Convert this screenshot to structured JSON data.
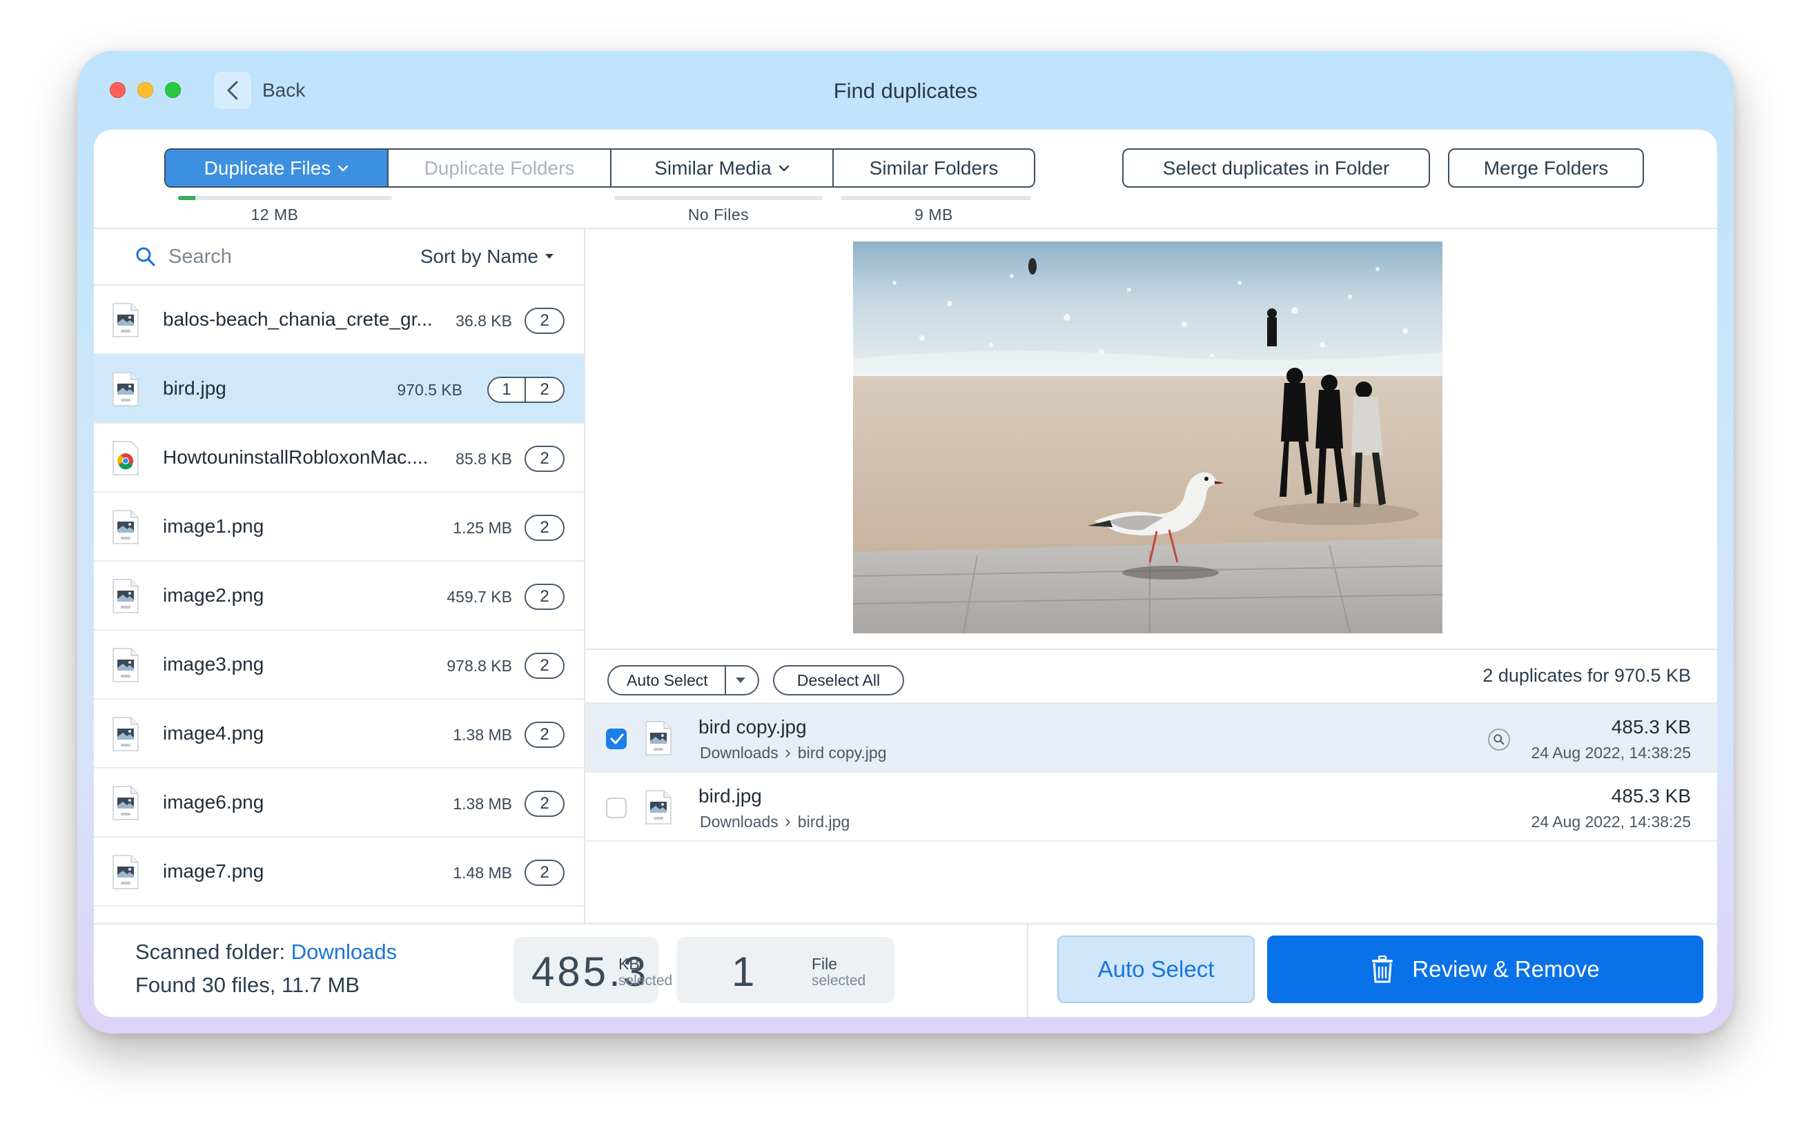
{
  "window": {
    "back_label": "Back",
    "title": "Find duplicates"
  },
  "tabs": [
    {
      "label": "Duplicate Files",
      "size": "12 MB",
      "progress": 0.08
    },
    {
      "label": "Duplicate Folders",
      "size": ""
    },
    {
      "label": "Similar Media",
      "size": "No Files"
    },
    {
      "label": "Similar Folders",
      "size": "9 MB"
    }
  ],
  "actions": {
    "select_in_folder": "Select duplicates in Folder",
    "merge_folders": "Merge Folders"
  },
  "search": {
    "placeholder": "Search",
    "sort_label": "Sort by Name"
  },
  "files": [
    {
      "name": "balos-beach_chania_crete_gr...",
      "size": "36.8 KB",
      "count": "2",
      "type": "JPG"
    },
    {
      "name": "bird.jpg",
      "size": "970.5 KB",
      "count_a": "1",
      "count_b": "2",
      "type": "JPG"
    },
    {
      "name": "HowtouninstallRobloxonMac....",
      "size": "85.8 KB",
      "count": "2",
      "type": "chrome"
    },
    {
      "name": "image1.png",
      "size": "1.25 MB",
      "count": "2",
      "type": "PNG"
    },
    {
      "name": "image2.png",
      "size": "459.7 KB",
      "count": "2",
      "type": "PNG"
    },
    {
      "name": "image3.png",
      "size": "978.8 KB",
      "count": "2",
      "type": "PNG"
    },
    {
      "name": "image4.png",
      "size": "1.38 MB",
      "count": "2",
      "type": "PNG"
    },
    {
      "name": "image6.png",
      "size": "1.38 MB",
      "count": "2",
      "type": "PNG"
    },
    {
      "name": "image7.png",
      "size": "1.48 MB",
      "count": "2",
      "type": "PNG"
    }
  ],
  "detail": {
    "auto_select": "Auto Select",
    "deselect_all": "Deselect All",
    "summary": "2 duplicates for 970.5 KB",
    "duplicates": [
      {
        "name": "bird copy.jpg",
        "folder": "Downloads",
        "file": "bird copy.jpg",
        "size": "485.3 KB",
        "date": "24 Aug 2022, 14:38:25",
        "checked": true
      },
      {
        "name": "bird.jpg",
        "folder": "Downloads",
        "file": "bird.jpg",
        "size": "485.3 KB",
        "date": "24 Aug 2022, 14:38:25",
        "checked": false
      }
    ]
  },
  "footer": {
    "scanned_prefix": "Scanned folder: ",
    "scanned_folder": "Downloads",
    "found": "Found 30 files, 11.7 MB",
    "selected_size": "485.3",
    "selected_size_unit": "KB",
    "selected_size_sub": "selected",
    "selected_files": "1",
    "selected_files_unit": "File",
    "selected_files_sub": "selected",
    "auto_select": "Auto Select",
    "review_remove": "Review & Remove"
  },
  "colors": {
    "accent": "#0a72e8",
    "tab_active": "#3d8fe0",
    "row_selected": "#cfe9fb",
    "progress": "#3aaa5c"
  }
}
